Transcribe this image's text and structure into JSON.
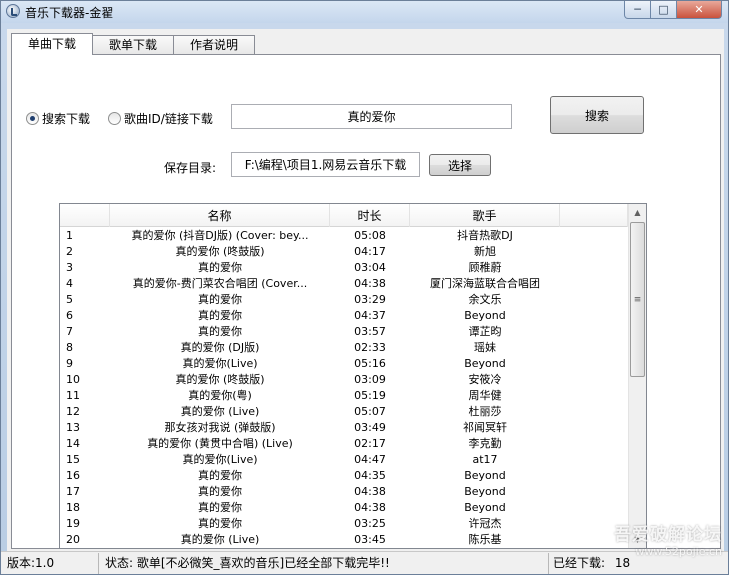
{
  "window": {
    "title": "音乐下载器-金翟",
    "buttons": {
      "minimize": "─",
      "maximize": "□",
      "close": "✕"
    }
  },
  "tabs": [
    {
      "label": "单曲下载",
      "active": true
    },
    {
      "label": "歌单下载",
      "active": false
    },
    {
      "label": "作者说明",
      "active": false
    }
  ],
  "search": {
    "mode_search_label": "搜索下载",
    "mode_id_label": "歌曲ID/链接下载",
    "selected_mode": "search",
    "query_value": "真的爱你",
    "search_button": "搜索"
  },
  "save": {
    "label": "保存目录:",
    "path_value": "F:\\编程\\项目1.网易云音乐下载",
    "choose_button": "选择"
  },
  "table": {
    "columns": [
      "",
      "名称",
      "时长",
      "歌手"
    ],
    "rows": [
      {
        "no": "1",
        "name": "真的爱你 (抖音DJ版) (Cover: bey...",
        "duration": "05:08",
        "artist": "抖音热歌DJ"
      },
      {
        "no": "2",
        "name": "真的爱你 (咚鼓版)",
        "duration": "04:17",
        "artist": "新旭"
      },
      {
        "no": "3",
        "name": "真的爱你",
        "duration": "03:04",
        "artist": "顾稚蔚"
      },
      {
        "no": "4",
        "name": "真的爱你-费门菜农合唱团 (Cover...",
        "duration": "04:38",
        "artist": "厦门深海蓝联合合唱团"
      },
      {
        "no": "5",
        "name": "真的爱你",
        "duration": "03:29",
        "artist": "余文乐"
      },
      {
        "no": "6",
        "name": "真的爱你",
        "duration": "04:37",
        "artist": "Beyond"
      },
      {
        "no": "7",
        "name": "真的爱你",
        "duration": "03:57",
        "artist": "谭芷昀"
      },
      {
        "no": "8",
        "name": "真的爱你 (DJ版)",
        "duration": "02:33",
        "artist": "瑶妹"
      },
      {
        "no": "9",
        "name": "真的爱你(Live)",
        "duration": "05:16",
        "artist": "Beyond"
      },
      {
        "no": "10",
        "name": "真的爱你 (咚鼓版)",
        "duration": "03:09",
        "artist": "安筱冷"
      },
      {
        "no": "11",
        "name": "真的爱你(粤)",
        "duration": "05:19",
        "artist": "周华健"
      },
      {
        "no": "12",
        "name": "真的爱你 (Live)",
        "duration": "05:07",
        "artist": "杜丽莎"
      },
      {
        "no": "13",
        "name": "那女孩对我说 (弹鼓版)",
        "duration": "03:49",
        "artist": "祁闻冥轩"
      },
      {
        "no": "14",
        "name": "真的爱你 (黄贯中合唱) (Live)",
        "duration": "02:17",
        "artist": "李克勤"
      },
      {
        "no": "15",
        "name": "真的爱你(Live)",
        "duration": "04:47",
        "artist": "at17"
      },
      {
        "no": "16",
        "name": "真的爱你",
        "duration": "04:35",
        "artist": "Beyond"
      },
      {
        "no": "17",
        "name": "真的爱你",
        "duration": "04:38",
        "artist": "Beyond"
      },
      {
        "no": "18",
        "name": "真的爱你",
        "duration": "04:38",
        "artist": "Beyond"
      },
      {
        "no": "19",
        "name": "真的爱你",
        "duration": "03:25",
        "artist": "许冠杰"
      },
      {
        "no": "20",
        "name": "真的爱你 (Live)",
        "duration": "03:45",
        "artist": "陈乐基"
      }
    ]
  },
  "statusbar": {
    "version": "版本:1.0",
    "status": "状态: 歌单[不必微笑_喜欢的音乐]已经全部下载完毕!!",
    "downloaded_label": "已经下载:",
    "downloaded_count": "18"
  },
  "watermark": {
    "line1": "吾爱破解论坛",
    "line2": "www.52pojie.cn"
  },
  "colors": {
    "title_bg": "#c9d9ec",
    "close_button": "#c9523d",
    "selected_tab": "#ffffff"
  }
}
